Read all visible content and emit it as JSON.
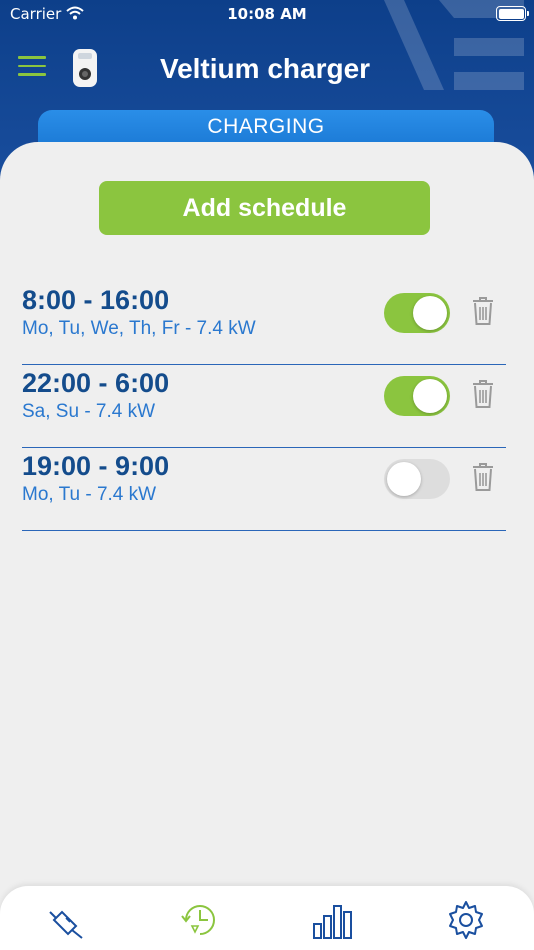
{
  "status_bar": {
    "carrier": "Carrier",
    "time": "10:08 AM"
  },
  "header": {
    "title": "Veltium charger",
    "mode_tab": "CHARGING"
  },
  "actions": {
    "add_schedule": "Add schedule"
  },
  "schedules": [
    {
      "time": "8:00 - 16:00",
      "details": "Mo, Tu, We, Th, Fr - 7.4 kW",
      "enabled": true
    },
    {
      "time": "22:00 - 6:00",
      "details": "Sa, Su - 7.4 kW",
      "enabled": true
    },
    {
      "time": "19:00 - 9:00",
      "details": "Mo, Tu - 7.4 kW",
      "enabled": false
    }
  ],
  "bottom_nav": [
    {
      "icon": "charging-plug-icon",
      "active": false
    },
    {
      "icon": "schedule-clock-icon",
      "active": true
    },
    {
      "icon": "statistics-bar-chart-icon",
      "active": false
    },
    {
      "icon": "settings-gear-icon",
      "active": false
    }
  ],
  "colors": {
    "header_blue": "#0d3f8a",
    "accent_green": "#8bc53f",
    "tab_blue": "#1976d2",
    "text_dark_blue": "#144c8c",
    "text_blue": "#2a78cf"
  }
}
